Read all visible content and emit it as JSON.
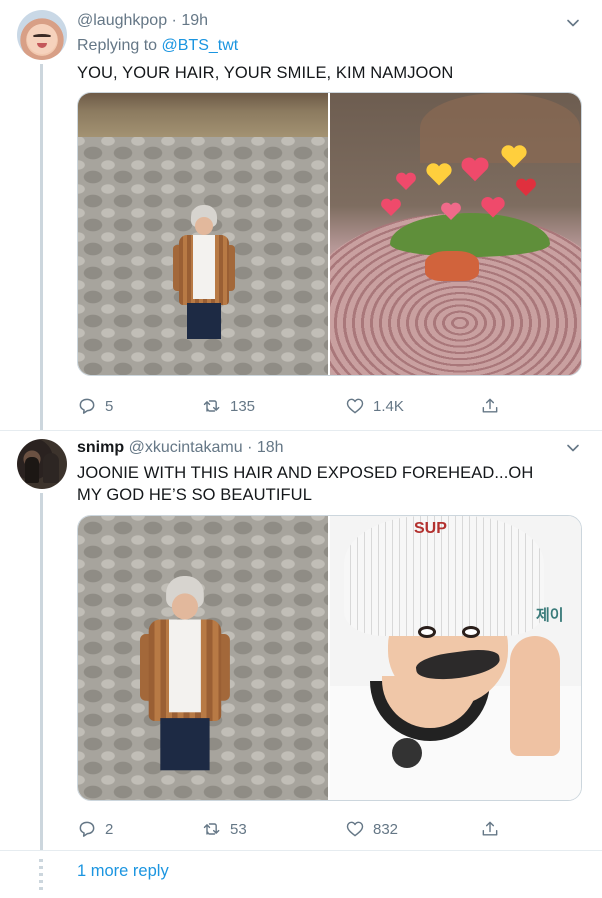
{
  "tweets": [
    {
      "name": "",
      "handle": "@laughkpop",
      "time": "19h",
      "reply_prefix": "Replying to ",
      "reply_to": "@BTS_twt",
      "text_lines": [
        "YOU, YOUR HAIR, YOUR SMILE, KIM NAMJOON"
      ],
      "actions": {
        "replies": "5",
        "retweets": "135",
        "likes": "1.4K"
      },
      "media_icons": [
        "photo-namjoon-stone-wall",
        "photo-crab-hearts"
      ]
    },
    {
      "name": "snimp",
      "handle": "@xkucintakamu",
      "time": "18h",
      "reply_prefix": "",
      "reply_to": "",
      "text_lines": [
        "JOONIE WITH THIS HAIR AND EXPOSED FOREHEAD...OH",
        "MY GOD HE’S SO BEAUTIFUL"
      ],
      "actions": {
        "replies": "2",
        "retweets": "53",
        "likes": "832"
      },
      "media_icons": [
        "photo-namjoon-stone-wall",
        "photo-jhope-bucket-hat"
      ],
      "media_text": {
        "hat_logo": "SUP",
        "sign": "제이"
      }
    }
  ],
  "separator": " · ",
  "more_replies": "1 more reply",
  "colors": {
    "link": "#1b95e0",
    "muted": "#657786",
    "text": "#14171a",
    "border": "#e6ecf0"
  },
  "icons": [
    "reply-icon",
    "retweet-icon",
    "like-icon",
    "share-icon",
    "chevron-down-icon"
  ]
}
